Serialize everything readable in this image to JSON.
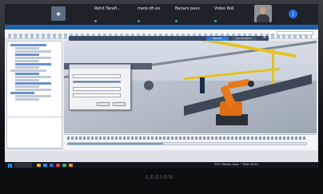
{
  "meeting": {
    "participants": [
      {
        "name": "Rohit Tarafi..."
      },
      {
        "name": "mere.dh.es"
      },
      {
        "name": "Banani pavs"
      },
      {
        "name": "Video Roli"
      }
    ],
    "info_icon": "i"
  },
  "notification": {
    "btn_primary": "Review",
    "btn_secondary": "Do not Show"
  },
  "taskbar": {
    "tray_text": "29°C Mostly clear  ^  ENG  10:52"
  },
  "screen": {
    "laptop_logo": "LEGION",
    "accent": "#1f5fa8",
    "robot_color": "#e8781a",
    "rail_color": "#e4c224"
  }
}
